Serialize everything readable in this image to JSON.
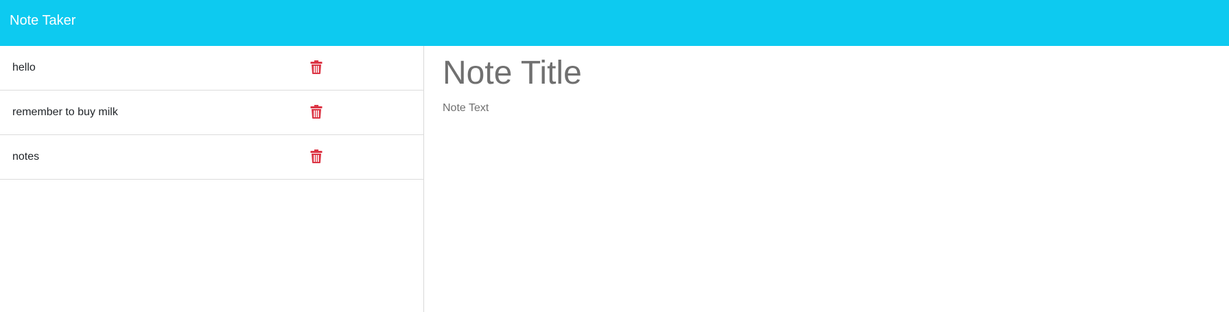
{
  "app": {
    "brand": "Note Taker",
    "accent_color": "#0dcaf0",
    "delete_color": "#dc3545"
  },
  "notes": [
    {
      "title": "hello",
      "delete_icon": "trash-icon"
    },
    {
      "title": "remember to buy milk",
      "delete_icon": "trash-icon"
    },
    {
      "title": "notes",
      "delete_icon": "trash-icon"
    }
  ],
  "editor": {
    "title_placeholder": "Note Title",
    "text_placeholder": "Note Text"
  }
}
